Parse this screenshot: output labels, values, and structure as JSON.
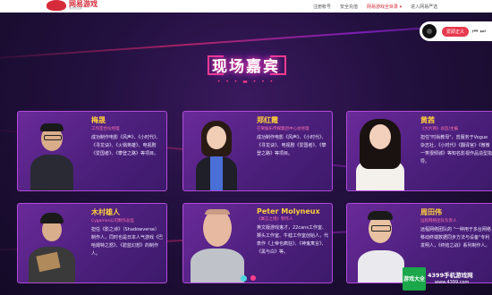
{
  "header": {
    "logo_text": "网易游戏",
    "logo_sub": "游戏热爱者",
    "nav": [
      {
        "label": "注册帐号"
      },
      {
        "label": "安全充值"
      },
      {
        "label": "网易游戏全目录 ▾"
      },
      {
        "label": "进入网易严选"
      }
    ]
  },
  "music": {
    "label": "爱即正义",
    "controls": "⏮ ⏭"
  },
  "section": {
    "title": "现场嘉宾",
    "dots": "• • • ▬ • • •"
  },
  "guests": [
    {
      "name": "梅晟",
      "role": "工作室合伙经理",
      "bio": "成功制作电影《风声》、《小时代》、《寻龙诀》、《火锅英雄》、电视剧《爱国者》、《攀登之路》等项目。"
    },
    {
      "name": "郑红霞",
      "role": "芒果娱乐传媒集团中心总经理",
      "bio": "成功制作电影《风声》、《小时代》、《寻龙诀》、电视剧《爱国者》、《攀登之路》等项目。"
    },
    {
      "name": "黄茜",
      "role": "《大片网》总监/主编",
      "bio": "担任\"时尚教母\"，曾服务于Vogue杂志社，《小时代》《翻译官》《微微一笑很倾城》等知名影视作品造型指导。"
    },
    {
      "name": "木村雄人",
      "role": "Cygames公司制作总监",
      "bio": "担任《影之诗》（Shadowverse）制作人，同时也是日本人气游戏《巴哈姆特之怒》、《碧蓝幻想》的制作人。"
    },
    {
      "name": "Peter Molyneux",
      "role": "《寓言之境》制作人",
      "bio": "英文版游戏鬼才，22cans工作室、狮头工作室、牛蛙工作室创始人，代表作《上帝也疯狂》、《神鬼寓言》、《黑与白》等。"
    },
    {
      "name": "周田伟",
      "role": "远程网络团队负责人",
      "bio": "远程网络团队的 \"一种用于多台网络移动终端数据同步方法与设备\"专利发明人，《终结之战》系列制作人。"
    }
  ],
  "watermark": {
    "badge": "游戏大全",
    "brand": "4399手机游戏网",
    "url": "www.4399.com"
  }
}
